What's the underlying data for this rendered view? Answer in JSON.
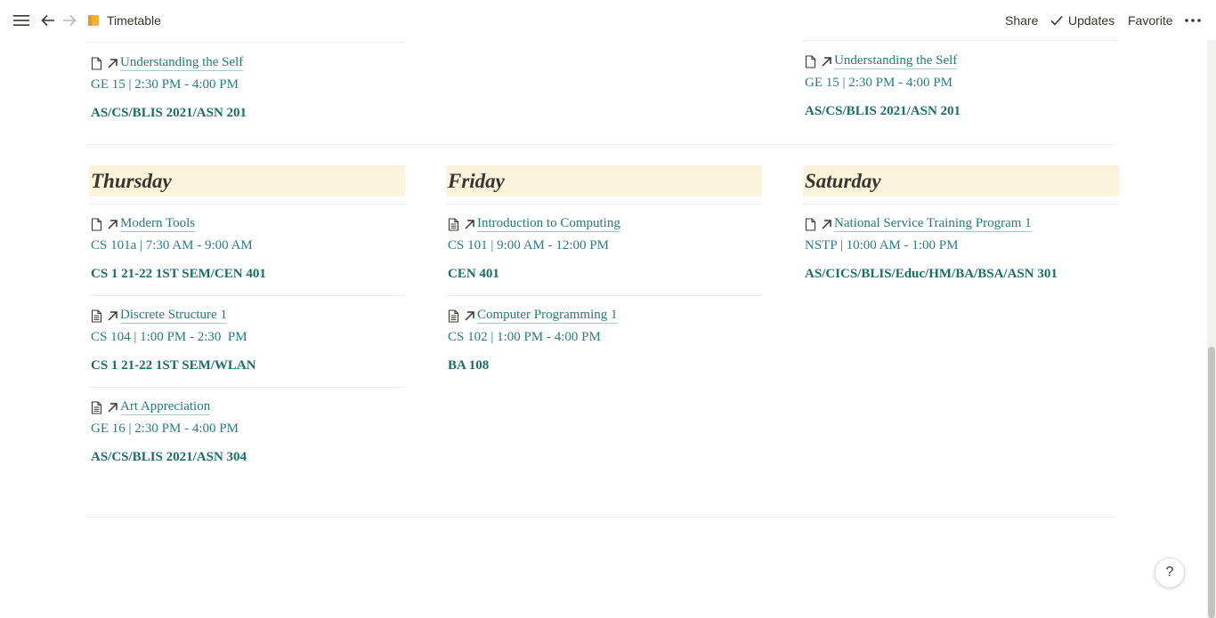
{
  "topbar": {
    "breadcrumb_title": "Timetable",
    "actions": {
      "share": "Share",
      "updates": "Updates",
      "favorite": "Favorite"
    }
  },
  "colors": {
    "link": "#237b74",
    "meta": "#2a7a8c",
    "room": "#1b6d66",
    "day_heading_bg": "#fbf3db"
  },
  "top_partial": {
    "col1": {
      "title": "Understanding the Self",
      "meta": "GE 15 | 2:30 PM - 4:00 PM",
      "room": "AS/CS/BLIS 2021/ASN 201",
      "icon": "page-icon"
    },
    "col3": {
      "title": "Understanding the Self",
      "meta": "GE 15 | 2:30 PM - 4:00 PM",
      "room": "AS/CS/BLIS 2021/ASN 201",
      "icon": "page-icon"
    }
  },
  "days": [
    {
      "name": "Thursday",
      "items": [
        {
          "title": "Modern Tools",
          "meta": "CS 101a | 7:30 AM - 9:00 AM",
          "room": "CS 1 21-22 1ST SEM/CEN 401",
          "icon": "page-icon"
        },
        {
          "title": "Discrete Structure 1",
          "meta": "CS 104 | 1:00 PM - 2:30  PM",
          "room": "CS 1 21-22 1ST SEM/WLAN",
          "icon": "page-text-icon"
        },
        {
          "title": "Art Appreciation",
          "meta": "GE 16 | 2:30 PM - 4:00 PM",
          "room": "AS/CS/BLIS 2021/ASN 304",
          "icon": "page-text-icon"
        }
      ]
    },
    {
      "name": "Friday",
      "items": [
        {
          "title": "Introduction to Computing",
          "meta": "CS 101 | 9:00 AM - 12:00 PM",
          "room": "CEN 401",
          "icon": "page-text-icon"
        },
        {
          "title": "Computer Programming 1",
          "meta": "CS 102 | 1:00 PM - 4:00 PM",
          "room": "BA 108",
          "icon": "page-text-icon"
        }
      ]
    },
    {
      "name": "Saturday",
      "items": [
        {
          "title": "National Service Training Program 1",
          "meta": "NSTP | 10:00 AM - 1:00 PM",
          "room": "AS/CICS/BLIS/Educ/HM/BA/BSA/ASN 301",
          "icon": "page-icon"
        }
      ]
    }
  ],
  "help_label": "?"
}
